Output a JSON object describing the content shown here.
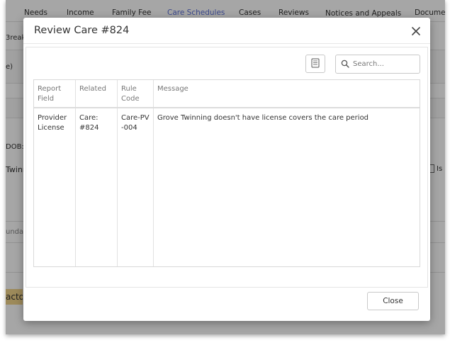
{
  "background": {
    "nav_tabs": [
      {
        "label": "Needs"
      },
      {
        "label": "Income"
      },
      {
        "label": "Family Fee"
      },
      {
        "label": "Care Schedules"
      },
      {
        "label": "Cases"
      },
      {
        "label": "Reviews"
      },
      {
        "label": "Notices and Appeals"
      },
      {
        "label": "Documer"
      }
    ],
    "fragments": {
      "break": "3reak",
      "paren": "e)",
      "dob": "DOB:",
      "twin": "Twinn",
      "sunday": "unday",
      "highlight": "acto",
      "checkbox_label": "Is"
    }
  },
  "dialog": {
    "title": "Review Care #824",
    "search": {
      "placeholder": "Search..."
    },
    "table": {
      "headers": [
        "Report Field",
        "Related",
        "Rule Code",
        "Message"
      ],
      "rows": [
        [
          "Provider License",
          "Care: #824",
          "Care-PV-004",
          "Grove Twinning doesn't have license covers the care period"
        ]
      ]
    },
    "close_label": "Close"
  },
  "colors": {
    "active_tab": "#5b6fd6",
    "highlight": "#f2d48a"
  }
}
